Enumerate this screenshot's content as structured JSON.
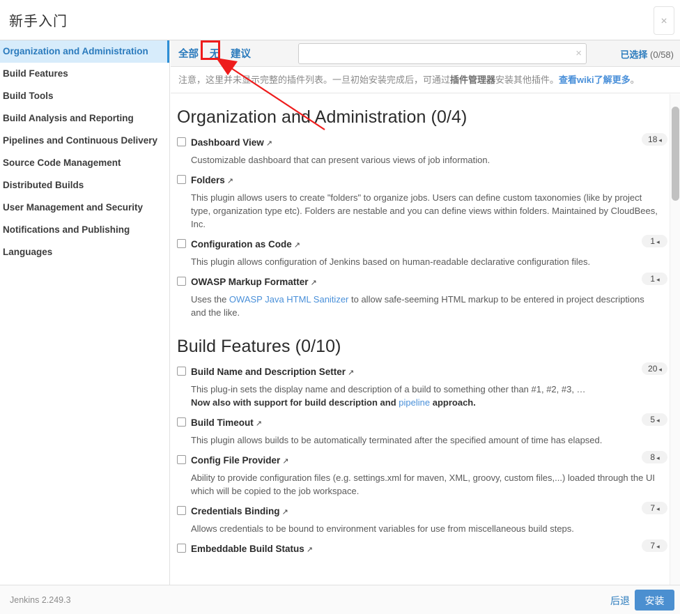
{
  "header": {
    "title": "新手入门",
    "close_icon": "close-icon"
  },
  "sidebar": {
    "items": [
      {
        "label": "Organization and Administration",
        "active": true
      },
      {
        "label": "Build Features",
        "active": false
      },
      {
        "label": "Build Tools",
        "active": false
      },
      {
        "label": "Build Analysis and Reporting",
        "active": false
      },
      {
        "label": "Pipelines and Continuous Delivery",
        "active": false
      },
      {
        "label": "Source Code Management",
        "active": false
      },
      {
        "label": "Distributed Builds",
        "active": false
      },
      {
        "label": "User Management and Security",
        "active": false
      },
      {
        "label": "Notifications and Publishing",
        "active": false
      },
      {
        "label": "Languages",
        "active": false
      }
    ]
  },
  "tabs": [
    {
      "label": "全部",
      "name": "tab-all"
    },
    {
      "label": "无",
      "name": "tab-none"
    },
    {
      "label": "建议",
      "name": "tab-suggested"
    }
  ],
  "search": {
    "value": "",
    "placeholder": "",
    "clear_icon": "clear-icon"
  },
  "selection": {
    "label": "已选择",
    "count": "(0/58)"
  },
  "notice": {
    "part1": "注意，这里并未显示完整的插件列表。一旦初始安装完成后，可通过",
    "bold": "插件管理器",
    "part2": "安装其他插件。",
    "link": "查看wiki了解更多",
    "part3": "。"
  },
  "sections": [
    {
      "title": "Organization and Administration (0/4)",
      "plugins": [
        {
          "name": "Dashboard View",
          "checked": false,
          "badge": "18",
          "desc_parts": [
            {
              "t": "Customizable dashboard that can present various views of job information.",
              "style": "plain"
            }
          ]
        },
        {
          "name": "Folders",
          "checked": false,
          "badge": "",
          "desc_parts": [
            {
              "t": "This plugin allows users to create \"folders\" to organize jobs. Users can define custom taxonomies (like by project type, organization type etc). Folders are nestable and you can define views within folders. Maintained by CloudBees, Inc.",
              "style": "plain"
            }
          ]
        },
        {
          "name": "Configuration as Code",
          "checked": false,
          "badge": "1",
          "desc_parts": [
            {
              "t": "This plugin allows configuration of Jenkins based on human-readable declarative configuration files.",
              "style": "plain"
            }
          ]
        },
        {
          "name": "OWASP Markup Formatter",
          "checked": false,
          "badge": "1",
          "desc_parts": [
            {
              "t": "Uses the ",
              "style": "plain"
            },
            {
              "t": "OWASP Java HTML Sanitizer",
              "style": "link"
            },
            {
              "t": " to allow safe-seeming HTML markup to be entered in project descriptions and the like.",
              "style": "plain"
            }
          ]
        }
      ]
    },
    {
      "title": "Build Features (0/10)",
      "plugins": [
        {
          "name": "Build Name and Description Setter",
          "checked": false,
          "badge": "20",
          "desc_parts": [
            {
              "t": "This plug-in sets the display name and description of a build to something other than #1, #2, #3, …",
              "style": "plain"
            },
            {
              "t": "\n",
              "style": "break"
            },
            {
              "t": "Now also with support for build description and ",
              "style": "bold"
            },
            {
              "t": "pipeline",
              "style": "link"
            },
            {
              "t": " approach.",
              "style": "bold"
            }
          ]
        },
        {
          "name": "Build Timeout",
          "checked": false,
          "badge": "5",
          "desc_parts": [
            {
              "t": "This plugin allows builds to be automatically terminated after the specified amount of time has elapsed.",
              "style": "plain"
            }
          ]
        },
        {
          "name": "Config File Provider",
          "checked": false,
          "badge": "8",
          "desc_parts": [
            {
              "t": "Ability to provide configuration files (e.g. settings.xml for maven, XML, groovy, custom files,...) loaded through the UI which will be copied to the job workspace.",
              "style": "plain"
            }
          ]
        },
        {
          "name": "Credentials Binding",
          "checked": false,
          "badge": "7",
          "desc_parts": [
            {
              "t": "Allows credentials to be bound to environment variables for use from miscellaneous build steps.",
              "style": "plain"
            }
          ]
        },
        {
          "name": "Embeddable Build Status",
          "checked": false,
          "badge": "7",
          "desc_parts": []
        }
      ]
    }
  ],
  "footer": {
    "version": "Jenkins 2.249.3",
    "back_label": "后退",
    "install_label": "安装"
  },
  "annotation": {
    "color": "#ee1c1c",
    "highlight_target": "tab-none"
  }
}
